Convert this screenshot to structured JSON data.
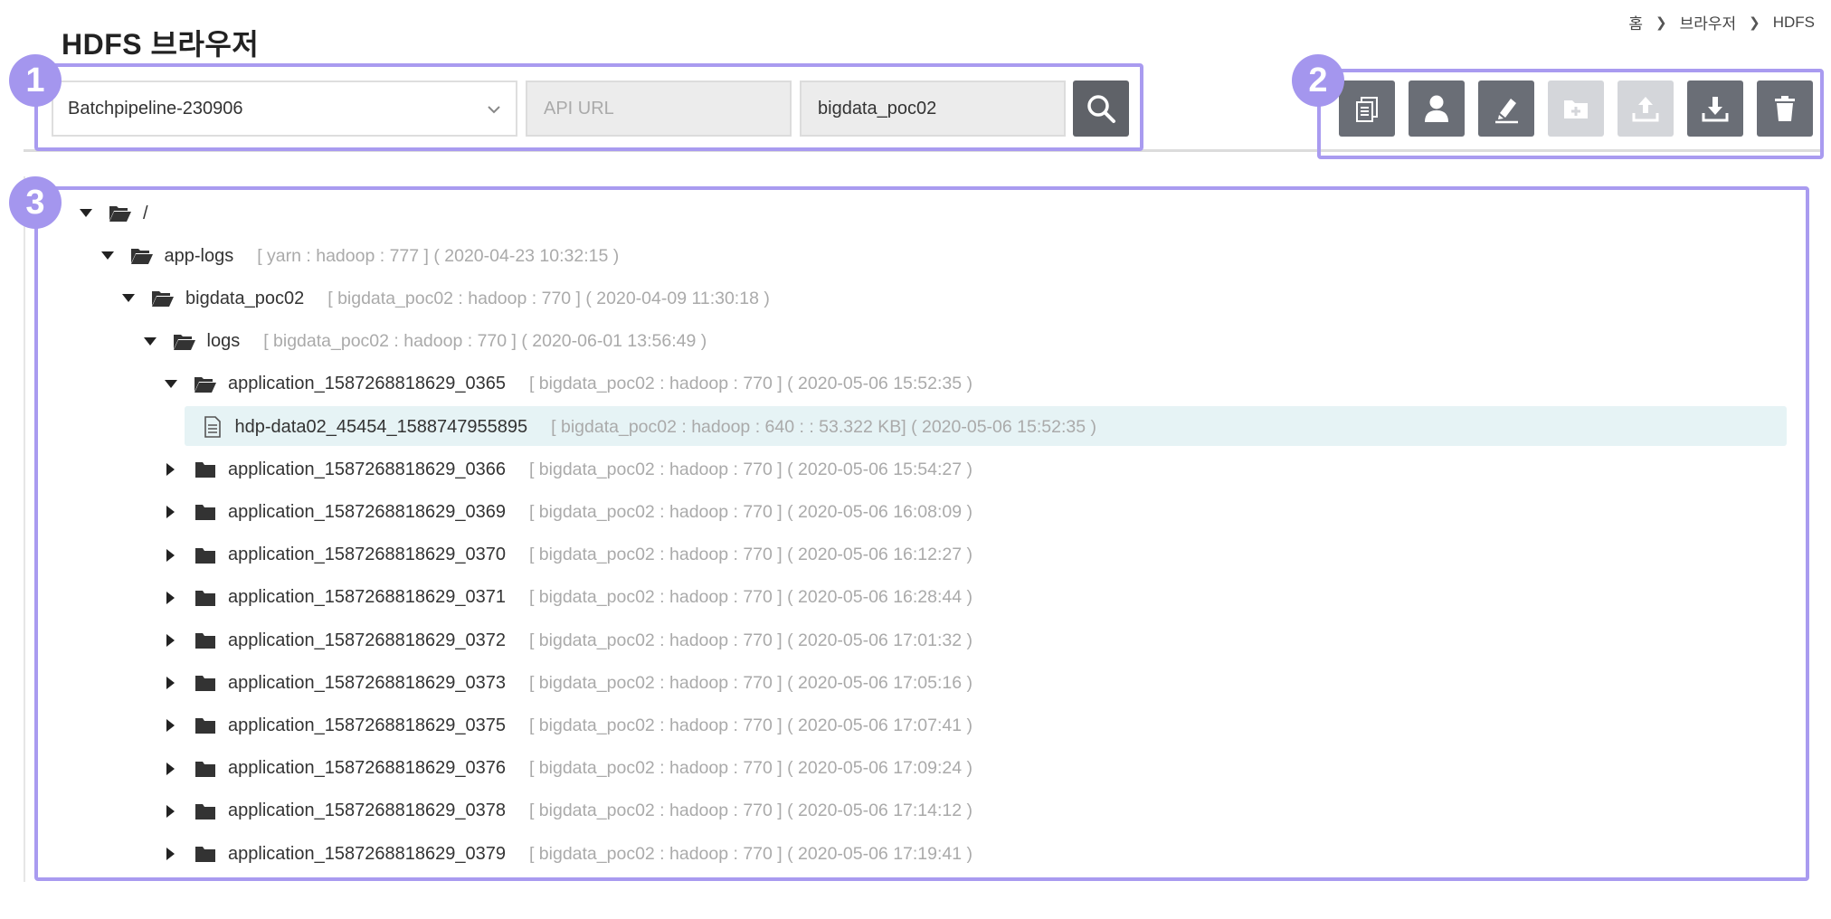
{
  "breadcrumb": [
    "홈",
    "브라우저",
    "HDFS"
  ],
  "page_title": "HDFS 브라우저",
  "callouts": [
    "1",
    "2",
    "3"
  ],
  "filters": {
    "pipeline_selected": "Batchpipeline-230906",
    "api_url_placeholder": "API URL",
    "user_value": "bigdata_poc02"
  },
  "toolbar_icons": [
    {
      "icon": "copy-icon",
      "enabled": true
    },
    {
      "icon": "user-icon",
      "enabled": true
    },
    {
      "icon": "edit-icon",
      "enabled": true
    },
    {
      "icon": "add-folder-icon",
      "enabled": false
    },
    {
      "icon": "upload-icon",
      "enabled": false
    },
    {
      "icon": "download-icon",
      "enabled": true
    },
    {
      "icon": "delete-icon",
      "enabled": true
    }
  ],
  "colors": {
    "callout": "#a99bf0",
    "button_dark": "#5f6268",
    "button_disabled": "#d4d6da",
    "selected_row": "#e6f3f5",
    "meta_text": "#aaaaaa"
  },
  "tree": [
    {
      "name": "/",
      "meta": "",
      "type": "folder",
      "state": "open",
      "depth": 0
    },
    {
      "name": "app-logs",
      "meta": "[ yarn : hadoop : 777 ] ( 2020-04-23 10:32:15 )",
      "type": "folder",
      "state": "open",
      "depth": 1
    },
    {
      "name": "bigdata_poc02",
      "meta": "[ bigdata_poc02 : hadoop : 770 ] ( 2020-04-09 11:30:18 )",
      "type": "folder",
      "state": "open",
      "depth": 2
    },
    {
      "name": "logs",
      "meta": "[ bigdata_poc02 : hadoop : 770 ] ( 2020-06-01 13:56:49 )",
      "type": "folder",
      "state": "open",
      "depth": 3
    },
    {
      "name": "application_1587268818629_0365",
      "meta": "[ bigdata_poc02 : hadoop : 770 ] ( 2020-05-06 15:52:35 )",
      "type": "folder",
      "state": "open",
      "depth": 4
    },
    {
      "name": "hdp-data02_45454_1588747955895",
      "meta": "[ bigdata_poc02 : hadoop : 640 : : 53.322 KB] ( 2020-05-06 15:52:35 )",
      "type": "file",
      "state": "selected",
      "depth": 5
    },
    {
      "name": "application_1587268818629_0366",
      "meta": "[ bigdata_poc02 : hadoop : 770 ] ( 2020-05-06 15:54:27 )",
      "type": "folder",
      "state": "closed",
      "depth": 4
    },
    {
      "name": "application_1587268818629_0369",
      "meta": "[ bigdata_poc02 : hadoop : 770 ] ( 2020-05-06 16:08:09 )",
      "type": "folder",
      "state": "closed",
      "depth": 4
    },
    {
      "name": "application_1587268818629_0370",
      "meta": "[ bigdata_poc02 : hadoop : 770 ] ( 2020-05-06 16:12:27 )",
      "type": "folder",
      "state": "closed",
      "depth": 4
    },
    {
      "name": "application_1587268818629_0371",
      "meta": "[ bigdata_poc02 : hadoop : 770 ] ( 2020-05-06 16:28:44 )",
      "type": "folder",
      "state": "closed",
      "depth": 4
    },
    {
      "name": "application_1587268818629_0372",
      "meta": "[ bigdata_poc02 : hadoop : 770 ] ( 2020-05-06 17:01:32 )",
      "type": "folder",
      "state": "closed",
      "depth": 4
    },
    {
      "name": "application_1587268818629_0373",
      "meta": "[ bigdata_poc02 : hadoop : 770 ] ( 2020-05-06 17:05:16 )",
      "type": "folder",
      "state": "closed",
      "depth": 4
    },
    {
      "name": "application_1587268818629_0375",
      "meta": "[ bigdata_poc02 : hadoop : 770 ] ( 2020-05-06 17:07:41 )",
      "type": "folder",
      "state": "closed",
      "depth": 4
    },
    {
      "name": "application_1587268818629_0376",
      "meta": "[ bigdata_poc02 : hadoop : 770 ] ( 2020-05-06 17:09:24 )",
      "type": "folder",
      "state": "closed",
      "depth": 4
    },
    {
      "name": "application_1587268818629_0378",
      "meta": "[ bigdata_poc02 : hadoop : 770 ] ( 2020-05-06 17:14:12 )",
      "type": "folder",
      "state": "closed",
      "depth": 4
    },
    {
      "name": "application_1587268818629_0379",
      "meta": "[ bigdata_poc02 : hadoop : 770 ] ( 2020-05-06 17:19:41 )",
      "type": "folder",
      "state": "closed",
      "depth": 4
    }
  ]
}
